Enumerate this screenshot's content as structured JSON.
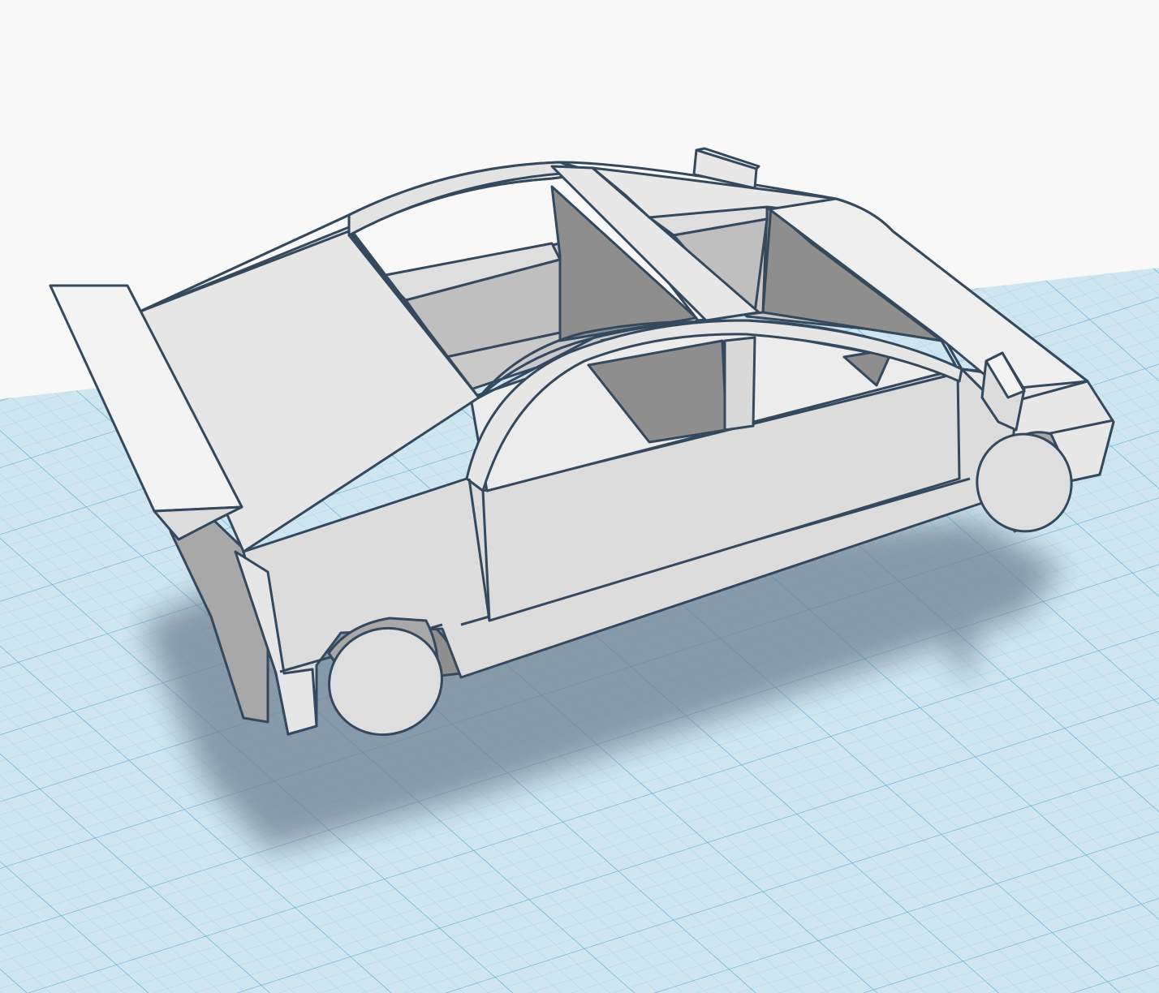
{
  "scene": {
    "model": "car-model",
    "colors": {
      "background": "#f8f8f8",
      "grid_fill": "#cfe6f0",
      "grid_fine": "#98cfe2",
      "grid_major": "#5aaed0",
      "body_light": "#f3f3f3",
      "body_mid": "#dcdcdc",
      "body_dark": "#a8a8a8",
      "body_darker": "#8e8e8e",
      "outline": "#34495e",
      "shadow": "#6f8192"
    }
  }
}
